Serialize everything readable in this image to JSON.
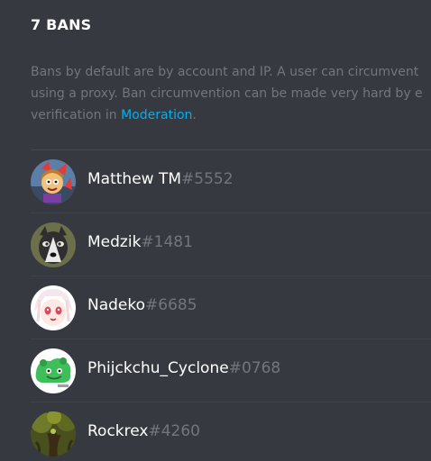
{
  "header": {
    "title": "7 BANS"
  },
  "description": {
    "line1": "Bans by default are by account and IP. A user can circumvent",
    "line2": "using a proxy. Ban circumvention can be made very hard by e",
    "line3_prefix": "verification in ",
    "link": "Moderation",
    "line3_suffix": "."
  },
  "colors": {
    "background": "#36393f",
    "link": "#00b0f4",
    "muted_text": "#72767d"
  },
  "bans": [
    {
      "name": "Matthew TM",
      "discriminator": "#5552",
      "avatar_icon": "cartoon-character-avatar"
    },
    {
      "name": "Medzik",
      "discriminator": "#1481",
      "avatar_icon": "husky-dog-avatar"
    },
    {
      "name": "Nadeko",
      "discriminator": "#6685",
      "avatar_icon": "anime-girl-avatar"
    },
    {
      "name": "Phijckchu_Cyclone",
      "discriminator": "#0768",
      "avatar_icon": "green-creature-avatar"
    },
    {
      "name": "Rockrex",
      "discriminator": "#4260",
      "avatar_icon": "forest-tree-avatar"
    }
  ]
}
